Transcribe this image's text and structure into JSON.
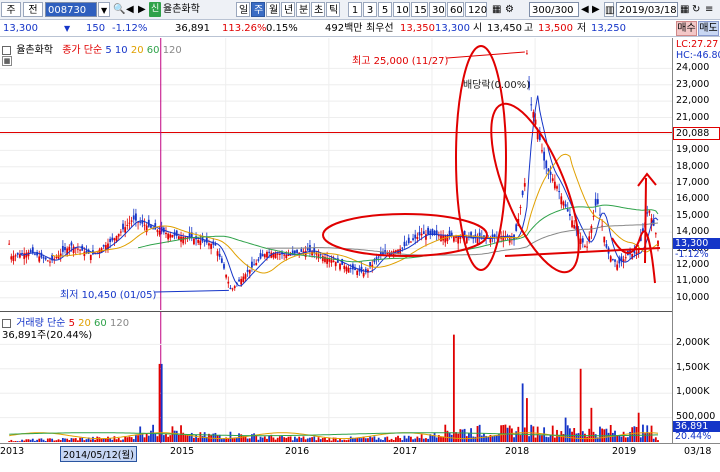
{
  "toolbar": {
    "field_ju": "주",
    "field_jeon": "전",
    "code": "008730",
    "name": "율촌화학",
    "sin": "신",
    "periods": [
      "일",
      "주",
      "월",
      "년",
      "분",
      "초",
      "틱"
    ],
    "active_period": "주",
    "intervals": [
      "1",
      "3",
      "5",
      "10",
      "15",
      "30",
      "60",
      "120"
    ],
    "count": "300/300",
    "date": "2019/03/18"
  },
  "info": {
    "price": "13,300",
    "arrow": "▼",
    "change": "150",
    "change_pct": "-1.12%",
    "volume": "36,891",
    "vol_ratio": "113.26%",
    "turnover_pct": "0.15%",
    "amount": "492백만",
    "label_best": "최우선",
    "bid": "13,350",
    "ask": "13,300",
    "label_si": "시",
    "open": "13,450",
    "label_go": "고",
    "high": "13,500",
    "label_jeo": "저",
    "low": "13,250",
    "buy": "매수",
    "sell": "매도"
  },
  "price_panel": {
    "stock_label": "율촌화학",
    "ma_label": "종가 단순",
    "ma_periods": [
      "5",
      "10",
      "20",
      "60",
      "120"
    ],
    "lc": "LC:27.27",
    "hc": "HC:-46.80",
    "max_label": "최고 25,000 (11/27)",
    "min_label": "최저 10,450 (01/05)",
    "annot_dividend": "배당락(0.00%)",
    "hline_value": "20,088",
    "current_price": "13,300",
    "current_pct": "-1.12%"
  },
  "volume_panel": {
    "label": "거래량 단순",
    "ma_periods": [
      "5",
      "20",
      "60",
      "120"
    ],
    "current": "36,891주(20.44%)",
    "tag_value": "36,891",
    "tag_pct": "20.44%"
  },
  "x_axis": {
    "ticks": [
      "2013",
      "2015",
      "2016",
      "2017",
      "2018",
      "2019",
      "03/18"
    ],
    "cursor_label": "2014/05/12(월)"
  },
  "chart_data": {
    "type": "candlestick",
    "price_axis": {
      "ticks": [
        "24,000",
        "23,000",
        "22,000",
        "21,000",
        "20,000",
        "19,000",
        "18,000",
        "17,000",
        "16,000",
        "15,000",
        "14,000",
        "13,000",
        "12,000",
        "11,000",
        "10,000"
      ],
      "range": [
        9500,
        25000
      ]
    },
    "volume_axis": {
      "ticks": [
        "2,000K",
        "1,500K",
        "1,000K",
        "500,000"
      ],
      "range": [
        0,
        2500000
      ]
    },
    "close_series": [
      [
        2012.9,
        12500
      ],
      [
        2013.1,
        12800
      ],
      [
        2013.3,
        12200
      ],
      [
        2013.5,
        13200
      ],
      [
        2013.7,
        12600
      ],
      [
        2013.9,
        13500
      ],
      [
        2014.1,
        14800
      ],
      [
        2014.3,
        14200
      ],
      [
        2014.5,
        13800
      ],
      [
        2014.7,
        13600
      ],
      [
        2014.9,
        13200
      ],
      [
        2015.0,
        11500
      ],
      [
        2015.05,
        10450
      ],
      [
        2015.2,
        11500
      ],
      [
        2015.4,
        12800
      ],
      [
        2015.6,
        12600
      ],
      [
        2015.8,
        12900
      ],
      [
        2016.0,
        12400
      ],
      [
        2016.2,
        11800
      ],
      [
        2016.35,
        11500
      ],
      [
        2016.5,
        12600
      ],
      [
        2016.7,
        13000
      ],
      [
        2016.9,
        13900
      ],
      [
        2017.1,
        13800
      ],
      [
        2017.3,
        13700
      ],
      [
        2017.5,
        13600
      ],
      [
        2017.7,
        13800
      ],
      [
        2017.8,
        13500
      ],
      [
        2017.9,
        17000
      ],
      [
        2017.92,
        25000
      ],
      [
        2017.95,
        22000
      ],
      [
        2018.0,
        21000
      ],
      [
        2018.1,
        18000
      ],
      [
        2018.2,
        17000
      ],
      [
        2018.3,
        15500
      ],
      [
        2018.45,
        13500
      ],
      [
        2018.5,
        13000
      ],
      [
        2018.6,
        16000
      ],
      [
        2018.7,
        12800
      ],
      [
        2018.8,
        12000
      ],
      [
        2018.9,
        12600
      ],
      [
        2019.0,
        12800
      ],
      [
        2019.1,
        15500
      ],
      [
        2019.2,
        13300
      ]
    ],
    "volume_series": [
      [
        2013.0,
        50000
      ],
      [
        2013.5,
        80000
      ],
      [
        2014.1,
        120000
      ],
      [
        2014.37,
        1600000
      ],
      [
        2014.6,
        150000
      ],
      [
        2015.0,
        200000
      ],
      [
        2015.5,
        120000
      ],
      [
        2016.0,
        90000
      ],
      [
        2016.5,
        100000
      ],
      [
        2017.0,
        150000
      ],
      [
        2017.22,
        2200000
      ],
      [
        2017.5,
        200000
      ],
      [
        2017.88,
        1200000
      ],
      [
        2017.92,
        900000
      ],
      [
        2018.3,
        500000
      ],
      [
        2018.45,
        1500000
      ],
      [
        2018.55,
        700000
      ],
      [
        2018.8,
        200000
      ],
      [
        2019.0,
        600000
      ],
      [
        2019.1,
        400000
      ],
      [
        2019.2,
        36891
      ]
    ],
    "ma_colors": {
      "ma5": "#1535c8",
      "ma10": "#e00000",
      "ma20": "#e0a000",
      "ma60": "#2fa24a",
      "ma120": "#888888"
    },
    "annotations": {
      "hline": 20088,
      "max": 25000,
      "min": 10450
    }
  }
}
